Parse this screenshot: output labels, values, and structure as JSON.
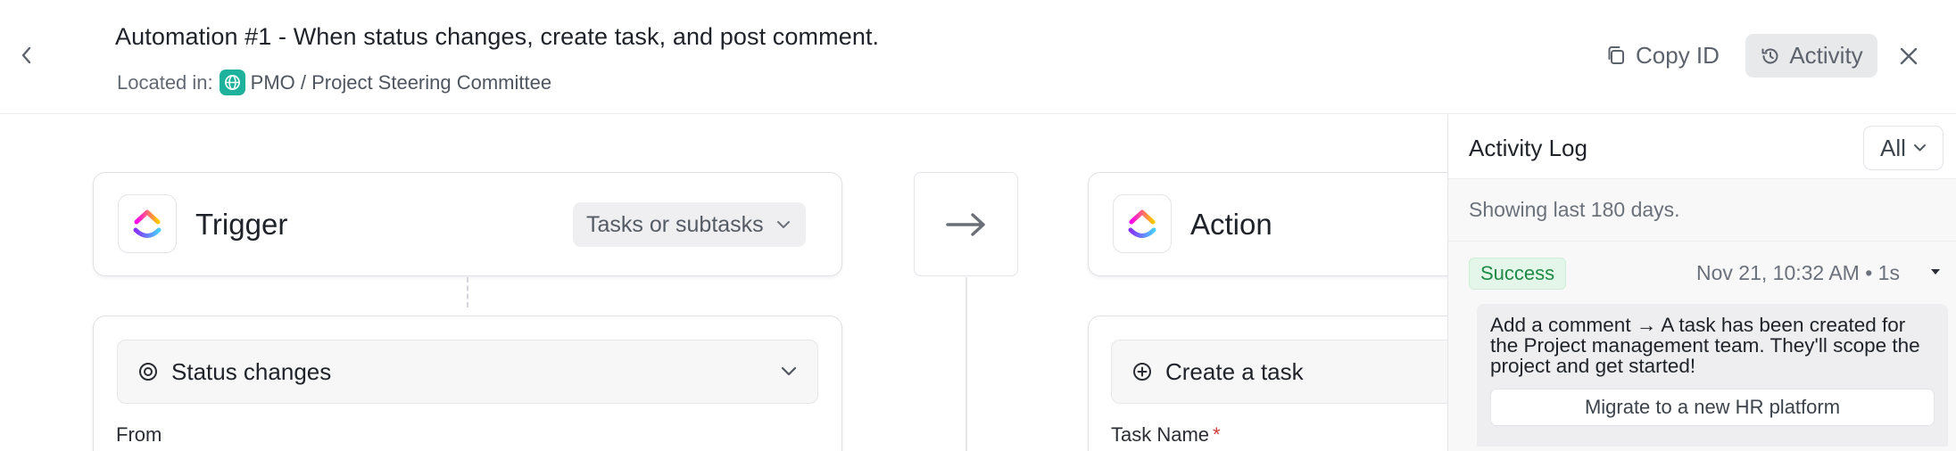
{
  "header": {
    "title": "Automation #1 - When status changes, create task, and post comment.",
    "location_label": "Located in:",
    "location_path": "PMO / Project Steering Committee",
    "copy_id_label": "Copy ID",
    "activity_label": "Activity",
    "icons": {
      "back": "chevron-left-icon",
      "globe": "globe-icon",
      "copy": "copy-icon",
      "history": "history-icon",
      "close": "close-icon"
    },
    "colors": {
      "globe_badge": "#1eb29c",
      "activity_button_bg": "#e8e9eb"
    }
  },
  "canvas": {
    "trigger": {
      "title": "Trigger",
      "scope_value": "Tasks or subtasks",
      "condition": "Status changes",
      "field_label": "From"
    },
    "action": {
      "title": "Action",
      "step": "Create a task",
      "field_label": "Task Name",
      "required_mark": "*"
    },
    "icons": {
      "app_logo": "clickup-logo",
      "arrow": "arrow-right-icon",
      "condition": "target-icon",
      "step": "plus-circle-icon"
    }
  },
  "activity_log": {
    "title": "Activity Log",
    "filter_value": "All",
    "range_note": "Showing last 180 days.",
    "entries": [
      {
        "status": "Success",
        "timestamp": "Nov 21, 10:32 AM • 1s",
        "message": "Add a comment → A task has been created for the Project management team. They'll scope the project and get started!",
        "task_name": "Migrate to a new HR platform"
      }
    ],
    "colors": {
      "success_text": "#1d8a45",
      "success_bg": "#e4f6ea"
    }
  }
}
